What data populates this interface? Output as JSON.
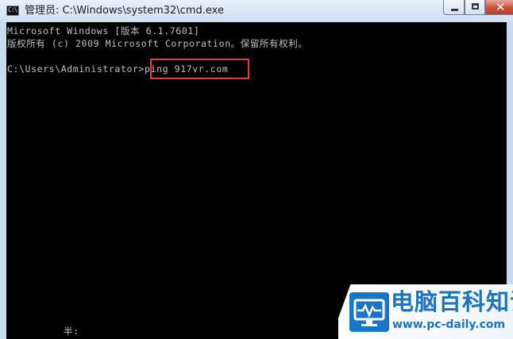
{
  "window": {
    "title": "管理员: C:\\Windows\\system32\\cmd.exe",
    "icon_text": "C:\\"
  },
  "controls": {
    "minimize_icon": "minimize-icon",
    "maximize_icon": "maximize-icon",
    "close_icon": "close-icon",
    "close_glyph": "✕"
  },
  "console": {
    "line1": "Microsoft Windows [版本 6.1.7601]",
    "line2": "版权所有 (c) 2009 Microsoft Corporation。保留所有权利。",
    "prompt": "C:\\Users\\Administrator>",
    "command": "ping 917vr.com",
    "ime_status": "半:"
  },
  "highlight": {
    "color": "#e23b3b"
  },
  "watermark": {
    "site_name": "电脑百科知识",
    "site_url": "www.pc-daily.com",
    "logo_icon": "monitor-pulse-icon",
    "brand_color": "#1a73c4"
  }
}
